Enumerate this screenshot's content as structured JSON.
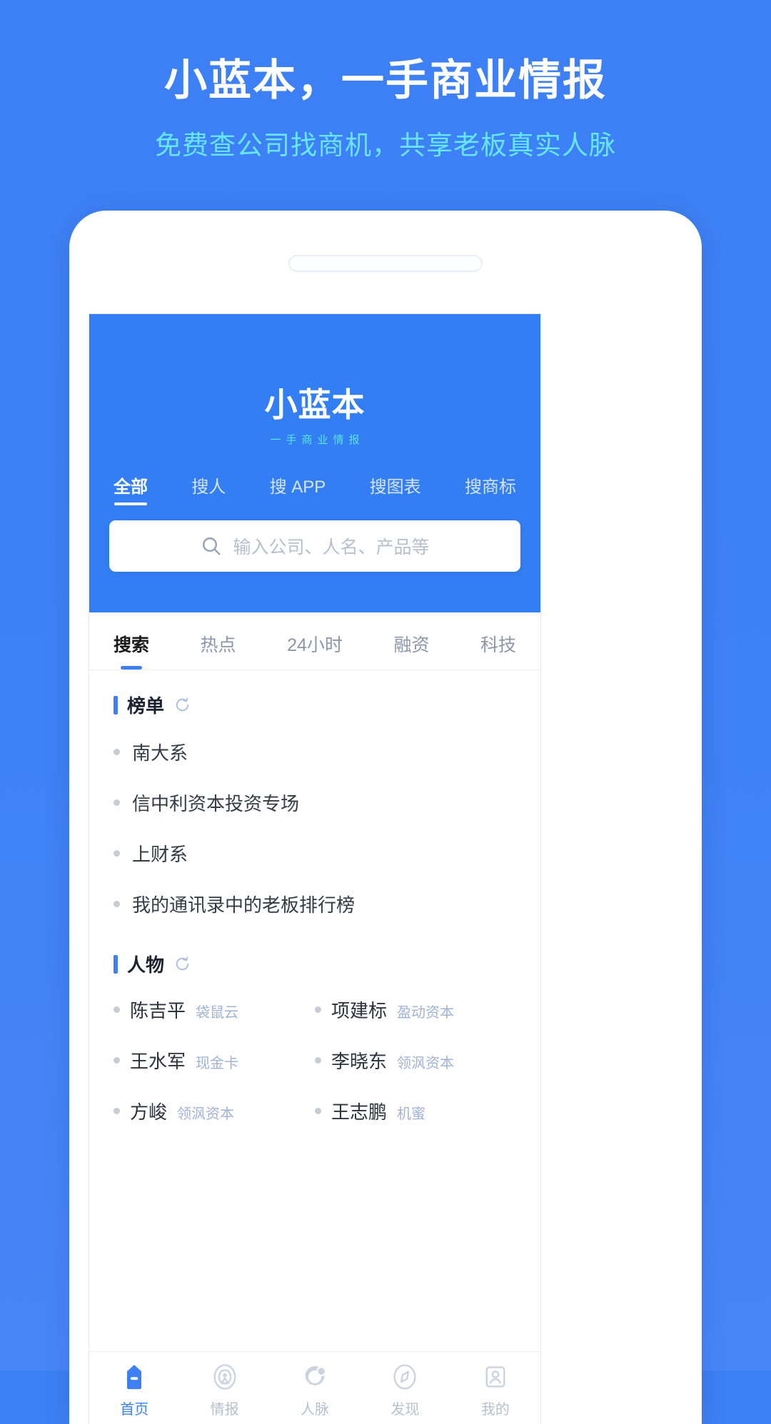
{
  "promo": {
    "title": "小蓝本，一手商业情报",
    "subtitle": "免费查公司找商机，共享老板真实人脉",
    "title_color": "#ffffff",
    "subtitle_color": "#66e6ff",
    "background_color": "#3d80f5"
  },
  "app": {
    "logo": {
      "name": "小蓝本",
      "tagline": "一手商业情报",
      "tagline_color": "#57e6e0"
    },
    "search": {
      "icon": "search-icon",
      "placeholder": "输入公司、人名、产品等",
      "value": "",
      "tabs": [
        {
          "label": "全部",
          "active": true
        },
        {
          "label": "搜人",
          "active": false
        },
        {
          "label": "搜 APP",
          "active": false
        },
        {
          "label": "搜图表",
          "active": false
        },
        {
          "label": "搜商标",
          "active": false
        }
      ]
    },
    "content_tabs": [
      {
        "label": "搜索",
        "active": true
      },
      {
        "label": "热点",
        "active": false
      },
      {
        "label": "24小时",
        "active": false
      },
      {
        "label": "融资",
        "active": false
      },
      {
        "label": "科技",
        "active": false
      }
    ],
    "sections": [
      {
        "title": "榜单",
        "refresh_icon": "refresh-icon",
        "accent_color": "#3d7ff4",
        "items": [
          {
            "label": "南大系"
          },
          {
            "label": "信中利资本投资专场"
          },
          {
            "label": "上财系"
          },
          {
            "label": "我的通讯录中的老板排行榜"
          }
        ]
      },
      {
        "title": "人物",
        "refresh_icon": "refresh-icon",
        "accent_color": "#3d7ff4",
        "people": [
          {
            "name": "陈吉平",
            "org": "袋鼠云"
          },
          {
            "name": "项建标",
            "org": "盈动资本"
          },
          {
            "name": "王水军",
            "org": "现金卡"
          },
          {
            "name": "李晓东",
            "org": "领沨资本"
          },
          {
            "name": "方峻",
            "org": "领沨资本"
          },
          {
            "name": "王志鹏",
            "org": "机蜜"
          }
        ]
      }
    ],
    "bottom_nav": [
      {
        "label": "首页",
        "icon": "home-bookmark-icon",
        "active": true
      },
      {
        "label": "情报",
        "icon": "radar-signal-icon",
        "active": false
      },
      {
        "label": "人脉",
        "icon": "contacts-circle-icon",
        "active": false
      },
      {
        "label": "发现",
        "icon": "compass-icon",
        "active": false
      },
      {
        "label": "我的",
        "icon": "profile-icon",
        "active": false
      }
    ]
  }
}
